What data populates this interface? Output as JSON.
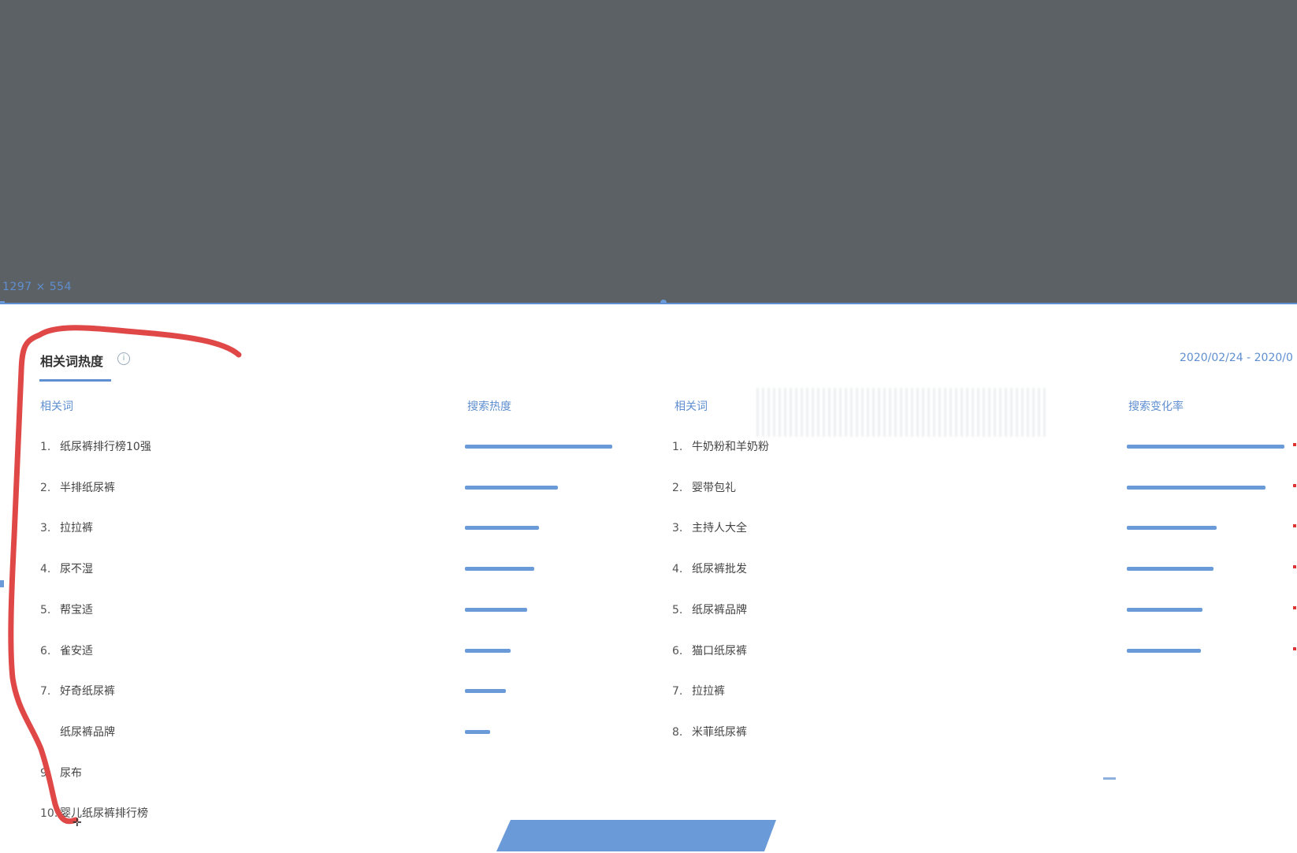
{
  "selection_size": "1297 × 554",
  "title": "相关词热度",
  "info_icon": "info-icon",
  "date_range": "2020/02/24 - 2020/0",
  "left_table": {
    "col_word": "相关词",
    "col_metric": "搜索热度",
    "rows": [
      {
        "num": "1.",
        "label": "纸尿裤排行榜10强",
        "value": 1.0
      },
      {
        "num": "2.",
        "label": "半排纸尿裤",
        "value": 0.63
      },
      {
        "num": "3.",
        "label": "拉拉裤",
        "value": 0.5
      },
      {
        "num": "4.",
        "label": "尿不湿",
        "value": 0.47
      },
      {
        "num": "5.",
        "label": "帮宝适",
        "value": 0.42
      },
      {
        "num": "6.",
        "label": "雀安适",
        "value": 0.31
      },
      {
        "num": "7.",
        "label": "好奇纸尿裤",
        "value": 0.28
      },
      {
        "num": "",
        "label": "纸尿裤品牌",
        "value": 0.17
      },
      {
        "num": "9.",
        "label": "尿布",
        "value": 0
      },
      {
        "num": "10.",
        "label": "婴儿纸尿裤排行榜",
        "value": 0
      }
    ]
  },
  "right_table": {
    "col_word": "相关词",
    "col_metric": "搜索变化率",
    "rows": [
      {
        "num": "1.",
        "label": "牛奶粉和羊奶粉",
        "value": 1.0
      },
      {
        "num": "2.",
        "label": "婴带包礼",
        "value": 0.88
      },
      {
        "num": "3.",
        "label": "主持人大全",
        "value": 0.57
      },
      {
        "num": "4.",
        "label": "纸尿裤批发",
        "value": 0.55
      },
      {
        "num": "5.",
        "label": "纸尿裤品牌",
        "value": 0.48
      },
      {
        "num": "6.",
        "label": "猫口纸尿裤",
        "value": 0.47
      },
      {
        "num": "7.",
        "label": "拉拉裤",
        "value": 0
      },
      {
        "num": "8.",
        "label": "米菲纸尿裤",
        "value": 0
      }
    ]
  },
  "colors": {
    "accent": "#5f8fd0",
    "bar": "#6a9ad8",
    "annotation": "#e04848",
    "backdrop": "#5c6166"
  }
}
